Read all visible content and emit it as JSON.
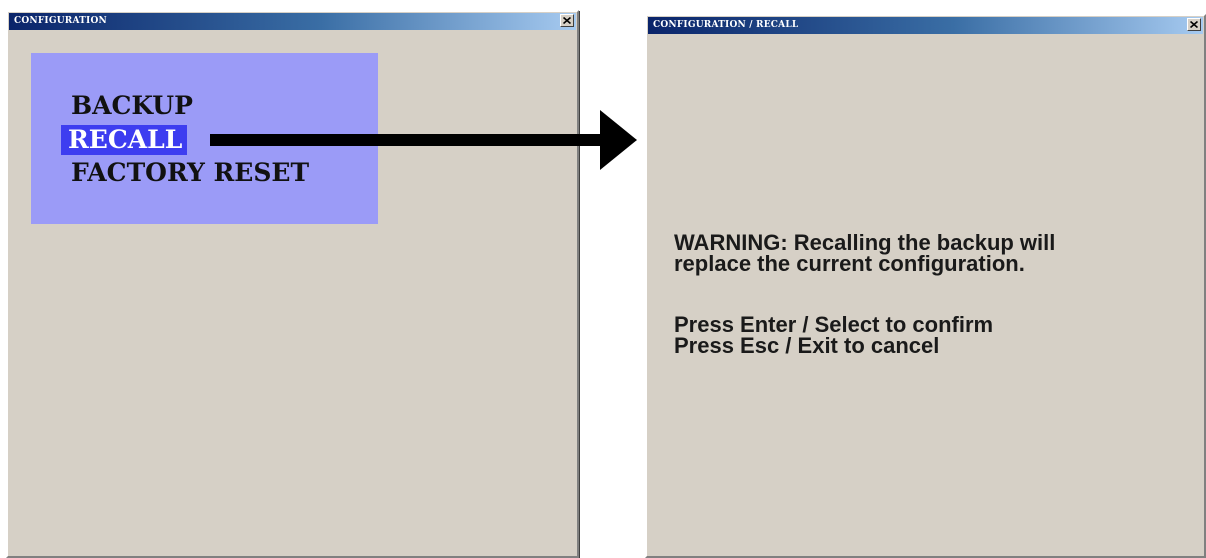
{
  "left_window": {
    "title": "CONFIGURATION",
    "menu": {
      "items": [
        {
          "label": "BACKUP",
          "selected": false
        },
        {
          "label": "RECALL",
          "selected": true
        },
        {
          "label": "FACTORY RESET",
          "selected": false
        }
      ]
    },
    "close_icon": "close-icon"
  },
  "right_window": {
    "title": "CONFIGURATION / RECALL",
    "close_icon": "close-icon",
    "warning_lines": [
      "WARNING:  Recalling the backup will",
      "replace the current configuration."
    ],
    "instructions": [
      "Press Enter / Select to confirm",
      "Press Esc / Exit to cancel"
    ]
  },
  "annotation": {
    "arrow_icon": "right-arrow-icon",
    "colors": {
      "menu_background": "#9b9bf7",
      "selection_highlight": "#3d3df0",
      "window_background": "#d6d0c6",
      "titlebar_start": "#0a246a"
    }
  }
}
